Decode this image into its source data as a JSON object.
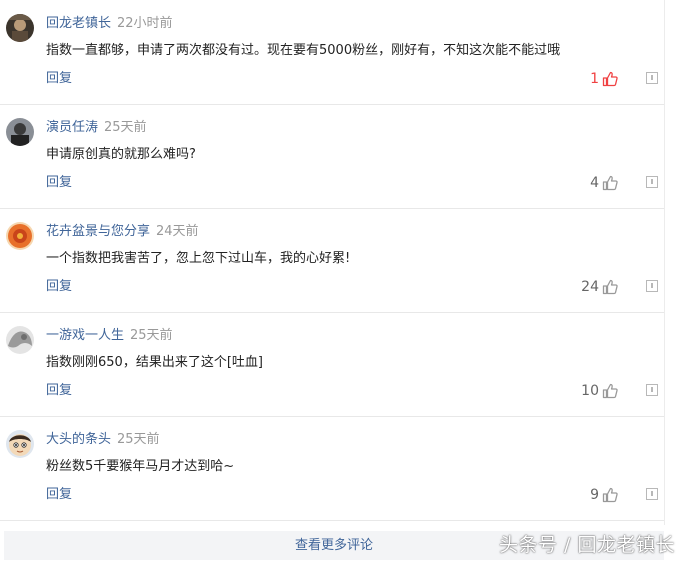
{
  "comments": [
    {
      "author": "回龙老镇长",
      "time": "22小时前",
      "text": "指数一直都够，申请了两次都没有过。现在要有5000粉丝，刚好有，不知这次能不能过哦",
      "reply": "回复",
      "likes": "1",
      "liked": true,
      "avatar": "avatar-dark"
    },
    {
      "author": "演员任涛",
      "time": "25天前",
      "text": "申请原创真的就那么难吗?",
      "reply": "回复",
      "likes": "4",
      "liked": false,
      "avatar": "avatar-person"
    },
    {
      "author": "花卉盆景与您分享",
      "time": "24天前",
      "text": "一个指数把我害苦了，忽上忽下过山车，我的心好累!",
      "reply": "回复",
      "likes": "24",
      "liked": false,
      "avatar": "avatar-orange"
    },
    {
      "author": "一游戏一人生",
      "time": "25天前",
      "text": "指数刚刚650，结果出来了这个[吐血]",
      "reply": "回复",
      "likes": "10",
      "liked": false,
      "avatar": "avatar-gray"
    },
    {
      "author": "大头的条头",
      "time": "25天前",
      "text": "粉丝数5千要猴年马月才达到哈~",
      "reply": "回复",
      "likes": "9",
      "liked": false,
      "avatar": "avatar-face"
    }
  ],
  "more_label": "查看更多评论",
  "watermark": "头条号 / 回龙老镇长",
  "colors": {
    "link": "#406599",
    "liked": "#f04142",
    "muted": "#999999"
  }
}
